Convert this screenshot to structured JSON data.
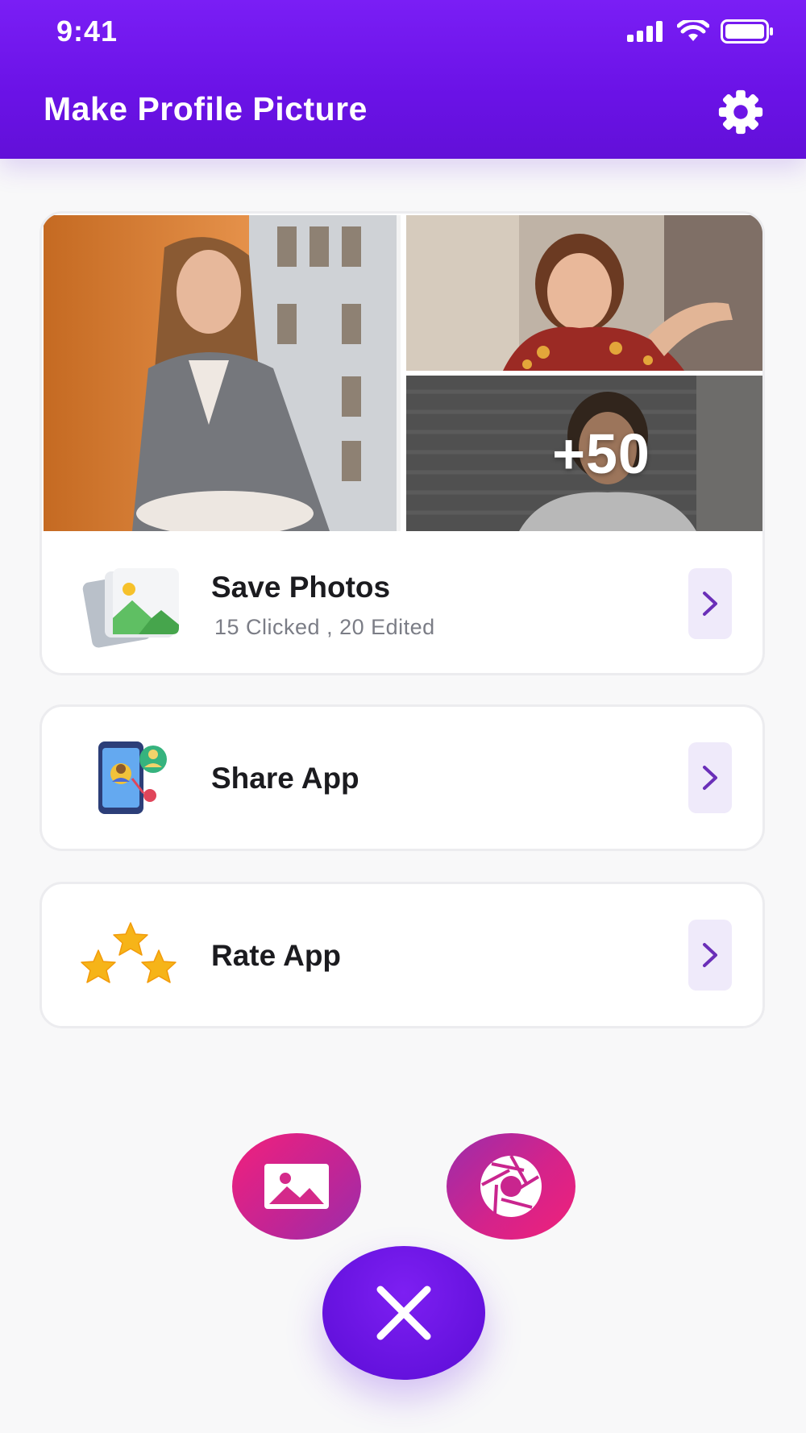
{
  "status_bar": {
    "time": "9:41",
    "icons": [
      "signal-icon",
      "wifi-icon",
      "battery-icon"
    ]
  },
  "header": {
    "title": "Make Profile Picture",
    "settings_icon": "gear-icon"
  },
  "gallery": {
    "more_count": "+50"
  },
  "menu": {
    "save_photos": {
      "title": "Save Photos",
      "subtitle": "15 Clicked , 20 Edited",
      "icon": "photos-stack-icon"
    },
    "share_app": {
      "title": "Share App",
      "icon": "share-phone-icon"
    },
    "rate_app": {
      "title": "Rate App",
      "icon": "stars-icon"
    }
  },
  "fabs": {
    "gallery_icon": "image-icon",
    "camera_icon": "aperture-icon",
    "close_icon": "close-icon"
  },
  "colors": {
    "header": "#6a12e6",
    "accent": "#7b2fc8",
    "chevron_bg": "#efeafa",
    "fab_pink": "#f0217a",
    "fab_purple": "#6512de"
  }
}
